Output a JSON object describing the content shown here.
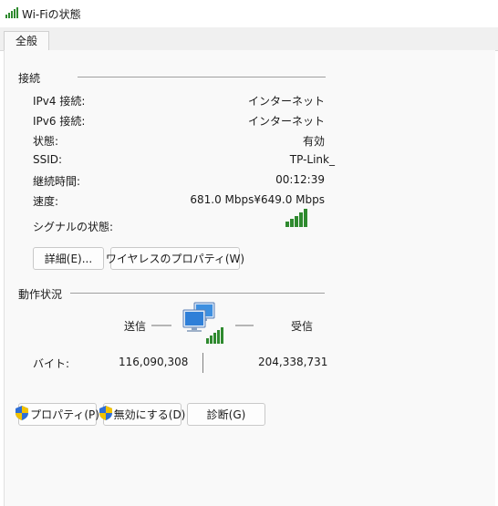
{
  "window": {
    "title": "Wi-Fiの状態"
  },
  "tabs": [
    {
      "label": "全般"
    }
  ],
  "connection": {
    "group_title": "接続",
    "rows": [
      {
        "label": "IPv4 接続:",
        "value": "インターネット"
      },
      {
        "label": "IPv6 接続:",
        "value": "インターネット"
      },
      {
        "label": "状態:",
        "value": "有効"
      },
      {
        "label": "SSID:",
        "value": "TP-Link_"
      },
      {
        "label": "継続時間:",
        "value": "00:12:39"
      },
      {
        "label": "速度:",
        "value": "681.0 Mbps¥649.0 Mbps"
      }
    ],
    "signal_label": "シグナルの状態:",
    "signal_bars": 5
  },
  "buttons_top": {
    "details": "詳細(E)...",
    "wireless_props": "ワイヤレスのプロパティ(W)"
  },
  "activity": {
    "group_title": "動作状況",
    "sent_label": "送信",
    "received_label": "受信",
    "bytes_label": "バイト:",
    "bytes_sent": "116,090,308",
    "bytes_received": "204,338,731"
  },
  "buttons_bottom": {
    "properties": "プロパティ(P)",
    "disable": "無効にする(D)",
    "diagnose": "診断(G)"
  },
  "colors": {
    "signal": "#2f8a2f",
    "shield_blue": "#2f6fd6",
    "shield_yellow": "#f2c200"
  }
}
